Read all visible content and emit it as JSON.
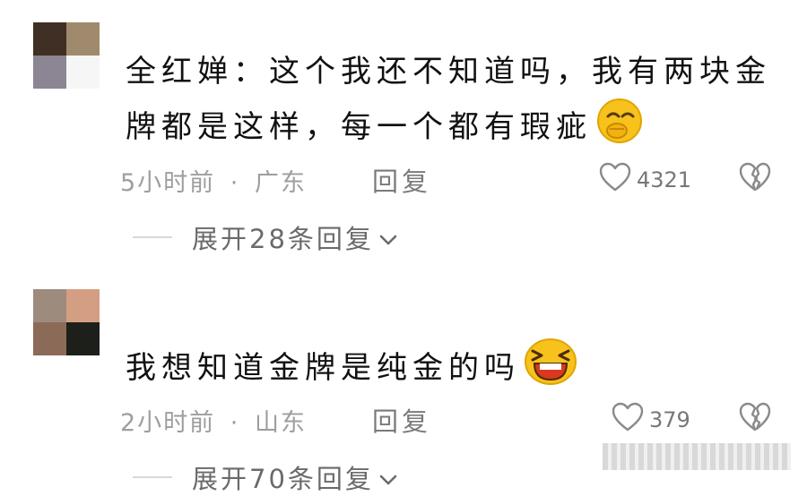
{
  "comments": [
    {
      "username": "",
      "text": "全红婵：这个我还不知道吗，我有两块金牌都是这样，每一个都有瑕疵",
      "emoji": "cover-mouth-laugh-emoji",
      "time": "5小时前",
      "separator": "·",
      "location": "广东",
      "reply_label": "回复",
      "likes": "4321",
      "expand_label": "展开28条回复"
    },
    {
      "username": "",
      "text": "我想知道金牌是纯金的吗",
      "emoji": "grin-squint-emoji",
      "time": "2小时前",
      "separator": "·",
      "location": "山东",
      "reply_label": "回复",
      "likes": "379",
      "expand_label": "展开70条回复"
    }
  ],
  "icons": {
    "like": "heart-outline-icon",
    "dislike": "broken-heart-icon",
    "expand": "chevron-down-icon"
  },
  "colors": {
    "text": "#111111",
    "meta": "#9e9e9e",
    "emoji_yellow": "#f7c21b"
  }
}
